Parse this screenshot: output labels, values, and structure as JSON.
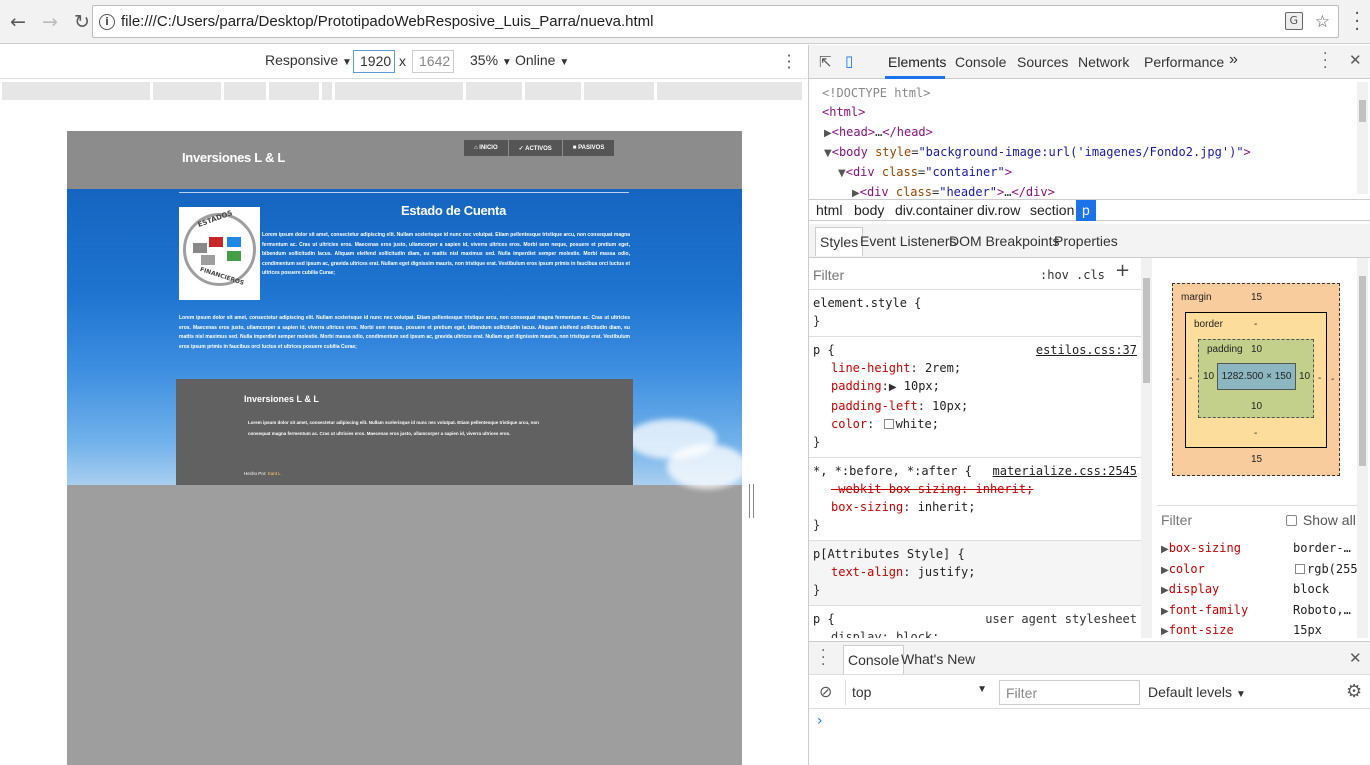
{
  "browser": {
    "url": "file:///C:/Users/parra/Desktop/PrototipadoWebResposive_Luis_Parra/nueva.html",
    "icons": [
      "back-arrow-icon",
      "forward-arrow-icon",
      "reload-icon",
      "info-icon",
      "translate-icon",
      "star-icon",
      "kebab-menu-icon"
    ]
  },
  "device_toolbar": {
    "mode": "Responsive",
    "width_value": "1920",
    "height_value": "1642",
    "times": "x",
    "zoom": "35%",
    "throttle": "Online"
  },
  "page": {
    "brand": "Inversiones L & L",
    "nav": [
      "INICIO",
      "ACTIVOS",
      "PASIVOS"
    ],
    "section_title": "Estado de Cuenta",
    "logo_top": "ESTADOS",
    "logo_bottom": "FINANCIEROS",
    "para1": "Lorem ipsum dolor sit amet, consectetur adipiscing elit. Nullam scelerisque id nunc nec volutpat. Etiam pellentesque tristique arcu, non consequat magna fermentum ac. Cras ut ultricies eros. Maecenas eros justo, ullamcorper a sapien id, viverra ultrices eros. Morbi sem neque, posuere et pretium eget, bibendum sollicitudin lacus. Aliquam eleifend sollicitudin diam, eu mattis nisl maximus sed. Nulla imperdiet semper molestie. Morbi massa odio, condimentum sed ipsum ac, gravida ultrices erat. Nullam eget dignissim mauris, non tristique erat. Vestibulum eros ipsum primis in faucibus orci luctus et ultrices posuere cubilia Curae;",
    "para2": "Lorem ipsum dolor sit amet, consectetur adipiscing elit. Nullam scelerisque id nunc nec volutpat. Etiam pellentesque tristique arcu, non consequat magna fermentum ac. Cras ut ultricies eros. Maecenas eros justo, ullamcorper a sapien id, viverra ultrices eros. Morbi sem neque, posuere et pretium eget, bibendum sollicitudin lacus. Aliquam eleifend sollicitudin diam, eu mattis nisl maximus sed. Nulla imperdiet semper molestie. Morbi massa odio, condimentum sed ipsum ac, gravida ultrices erat. Nullam eget dignissim mauris, non tristique erat. Vestibulum eros ipsum primis in faucibus orci luctus et ultrices posuere cubilia Curae;",
    "footer_title": "Inversiones L & L",
    "footer_text": "Lorem ipsum dolor sit amet, consectetur adipiscing elit. Nullam scelerisque id nunc nec volutpat. Etiam pellentesque tristique arcu, non consequat magna fermentum ac. Cras ut ultricies eros. Maecenas eros justo, ullamcorper a sapien id, viverra ultrices eros.",
    "footer_credit_prefix": "Hecho Por:",
    "footer_credit_name": "Kant L"
  },
  "devtools": {
    "tabs": [
      "Elements",
      "Console",
      "Sources",
      "Network",
      "Performance"
    ],
    "more": "»",
    "dom": {
      "doctype": "<!DOCTYPE html>",
      "html_open": "<html>",
      "head": "head",
      "head_dots": "…",
      "head_close": "</head>",
      "body_tag": "body",
      "body_attr": "style",
      "body_val": "\"background-image:url('imagenes/Fondo2.jpg')\"",
      "div_tag": "div",
      "class_attr": "class",
      "container_val": "\"container\"",
      "header_val": "\"header\"",
      "dots": "…",
      "div_close": "</div>"
    },
    "breadcrumbs": [
      "html",
      "body",
      "div.container",
      "div.row",
      "section",
      "p"
    ],
    "styles_tabs": [
      "Styles",
      "Event Listeners",
      "DOM Breakpoints",
      "Properties"
    ],
    "filter_placeholder": "Filter",
    "hov": ":hov",
    "cls": ".cls",
    "plus": "+",
    "rules": {
      "r1_sel": "element.style {",
      "close": "}",
      "r2_sel": "p {",
      "r2_src": "estilos.css:37",
      "r2_p1n": "line-height",
      "r2_p1v": "2rem;",
      "r2_p2n": "padding",
      "r2_p2v": "10px;",
      "r2_p3n": "padding-left",
      "r2_p3v": "10px;",
      "r2_p4n": "color",
      "r2_p4v": "white;",
      "r3_sel": "*, *:before, *:after {",
      "r3_src": "materialize.css:2545",
      "r3_p1": "-webkit-box-sizing: inherit;",
      "r3_p2n": "box-sizing",
      "r3_p2v": "inherit;",
      "r4_sel": "p[Attributes Style] {",
      "r4_p1n": "text-align",
      "r4_p1v": "justify;",
      "r5_sel": "p {",
      "r5_src": "user agent stylesheet",
      "r5_p1": "display: block;"
    },
    "box_model": {
      "margin_label": "margin",
      "margin_top": "15",
      "margin_bottom": "15",
      "margin_side": "-",
      "border_label": "border",
      "border_val": "-",
      "padding_label": "padding",
      "padding_top": "10",
      "padding_bottom": "10",
      "padding_left": "10",
      "padding_right": "10",
      "content": "1282.500 × 150"
    },
    "computed_filter": "Filter",
    "show_all": "Show all",
    "computed": [
      {
        "name": "box-sizing",
        "value": "border-…"
      },
      {
        "name": "color",
        "value": "rgb(255"
      },
      {
        "name": "display",
        "value": "block"
      },
      {
        "name": "font-family",
        "value": "Roboto,…"
      },
      {
        "name": "font-size",
        "value": "15px"
      }
    ],
    "drawer_tabs": [
      "Console",
      "What's New"
    ],
    "console_context": "top",
    "console_filter": "Filter",
    "default_levels": "Default levels",
    "prompt": "›"
  },
  "colors": {
    "accent": "#1a73e8",
    "css_property": "#c80000",
    "html_tag": "#881280",
    "html_attr": "#994500",
    "html_value": "#1a1aa6"
  }
}
